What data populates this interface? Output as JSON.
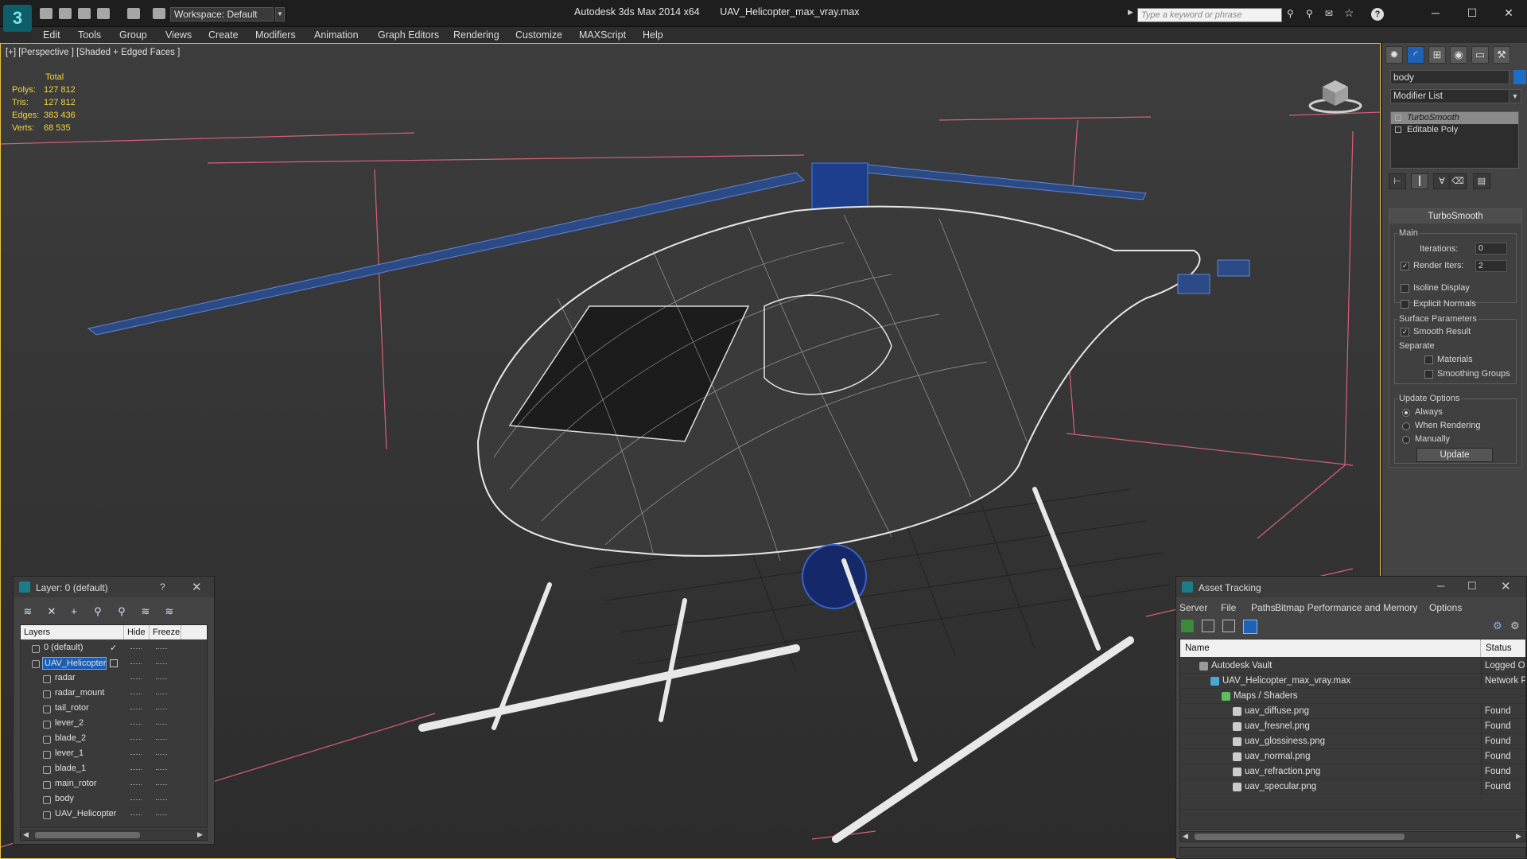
{
  "titlebar": {
    "workspace": "Workspace: Default",
    "app_title": "Autodesk 3ds Max  2014 x64",
    "file_name": "UAV_Helicopter_max_vray.max",
    "search_placeholder": "Type a keyword or phrase"
  },
  "menu": [
    "Edit",
    "Tools",
    "Group",
    "Views",
    "Create",
    "Modifiers",
    "Animation",
    "Graph Editors",
    "Rendering",
    "Customize",
    "MAXScript",
    "Help"
  ],
  "viewport": {
    "label": "[+] [Perspective ] [Shaded + Edged Faces ]",
    "stats": {
      "header": "Total",
      "polys_label": "Polys:",
      "polys": "127 812",
      "tris_label": "Tris:",
      "tris": "127 812",
      "edges_label": "Edges:",
      "edges": "383 436",
      "verts_label": "Verts:",
      "verts": "68 535"
    }
  },
  "command_panel": {
    "object_name": "body",
    "object_color": "#1b6fc6",
    "modifier_list": "Modifier List",
    "stack": [
      "TurboSmooth",
      "Editable Poly"
    ],
    "turbosmooth": {
      "title": "TurboSmooth",
      "main_label": "Main",
      "iterations_label": "Iterations:",
      "iterations": "0",
      "render_iters_label": "Render Iters:",
      "render_iters": "2",
      "isoline_label": "Isoline Display",
      "explicit_normals_label": "Explicit Normals",
      "surface_params_label": "Surface Parameters",
      "smooth_result_label": "Smooth Result",
      "separate_label": "Separate",
      "materials_label": "Materials",
      "smoothing_groups_label": "Smoothing Groups",
      "update_options_label": "Update Options",
      "always_label": "Always",
      "when_rendering_label": "When Rendering",
      "manually_label": "Manually",
      "update_button": "Update"
    }
  },
  "layer_dialog": {
    "title": "Layer: 0 (default)",
    "help": "?",
    "col_layers": "Layers",
    "col_hide": "Hide",
    "col_freeze": "Freeze",
    "rows": [
      {
        "name": "0 (default)",
        "level": 1,
        "check": "✓"
      },
      {
        "name": "UAV_Helicopter",
        "level": 1,
        "selected": true
      },
      {
        "name": "radar",
        "level": 2
      },
      {
        "name": "radar_mount",
        "level": 2
      },
      {
        "name": "tail_rotor",
        "level": 2
      },
      {
        "name": "lever_2",
        "level": 2
      },
      {
        "name": "blade_2",
        "level": 2
      },
      {
        "name": "lever_1",
        "level": 2
      },
      {
        "name": "blade_1",
        "level": 2
      },
      {
        "name": "main_rotor",
        "level": 2
      },
      {
        "name": "body",
        "level": 2
      },
      {
        "name": "UAV_Helicopter",
        "level": 2
      }
    ]
  },
  "asset_dialog": {
    "title": "Asset Tracking",
    "menu": [
      "Server",
      "File",
      "Paths",
      "Bitmap Performance and Memory",
      "Options"
    ],
    "col_name": "Name",
    "col_status": "Status",
    "rows": [
      {
        "name": "Autodesk Vault",
        "level": 1,
        "status": "Logged Out",
        "icon": "#9a9a9a"
      },
      {
        "name": "UAV_Helicopter_max_vray.max",
        "level": 2,
        "status": "Network Path",
        "icon": "#4aa8d8"
      },
      {
        "name": "Maps / Shaders",
        "level": 3,
        "status": "",
        "icon": "#5fbf5f"
      },
      {
        "name": "uav_diffuse.png",
        "level": 4,
        "status": "Found",
        "icon": "#cccccc"
      },
      {
        "name": "uav_fresnel.png",
        "level": 4,
        "status": "Found",
        "icon": "#cccccc"
      },
      {
        "name": "uav_glossiness.png",
        "level": 4,
        "status": "Found",
        "icon": "#cccccc"
      },
      {
        "name": "uav_normal.png",
        "level": 4,
        "status": "Found",
        "icon": "#cccccc"
      },
      {
        "name": "uav_refraction.png",
        "level": 4,
        "status": "Found",
        "icon": "#cccccc"
      },
      {
        "name": "uav_specular.png",
        "level": 4,
        "status": "Found",
        "icon": "#cccccc"
      }
    ]
  }
}
